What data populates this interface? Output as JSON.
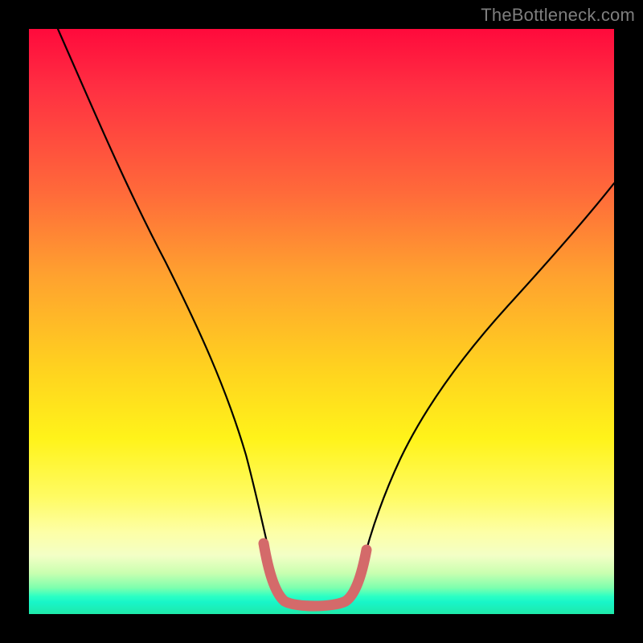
{
  "watermark": {
    "text": "TheBottleneck.com"
  },
  "colors": {
    "background": "#000000",
    "curve_stroke": "#000000",
    "highlight_stroke": "#d46a6a",
    "gradient_top": "#ff0a3c",
    "gradient_bottom": "#1fe9a9"
  },
  "chart_data": {
    "type": "line",
    "title": "",
    "xlabel": "",
    "ylabel": "",
    "xlim": [
      0,
      100
    ],
    "ylim": [
      0,
      100
    ],
    "grid": false,
    "legend": false,
    "note": "V-shaped bottleneck profile; y=100 at top, y≈0 at flat minimum, rising to ≈60 at right edge. Pink segment marks flat bottom region.",
    "series": [
      {
        "name": "curve",
        "x": [
          5,
          11,
          17,
          23,
          28,
          32,
          35,
          37.5,
          39.5,
          41.5,
          44,
          48,
          52,
          54,
          56.5,
          59,
          63,
          69,
          76,
          84,
          92,
          100
        ],
        "y": [
          100,
          86,
          73,
          60,
          47,
          36,
          26,
          17,
          10,
          5.5,
          2.5,
          1.5,
          1.5,
          2.5,
          5.5,
          10,
          17,
          26,
          35,
          44,
          52,
          60
        ]
      },
      {
        "name": "highlight",
        "x": [
          39.5,
          41.5,
          44,
          48,
          52,
          54,
          56.5
        ],
        "y": [
          10,
          5.5,
          2.5,
          1.5,
          1.5,
          2.5,
          5.5
        ]
      }
    ]
  }
}
